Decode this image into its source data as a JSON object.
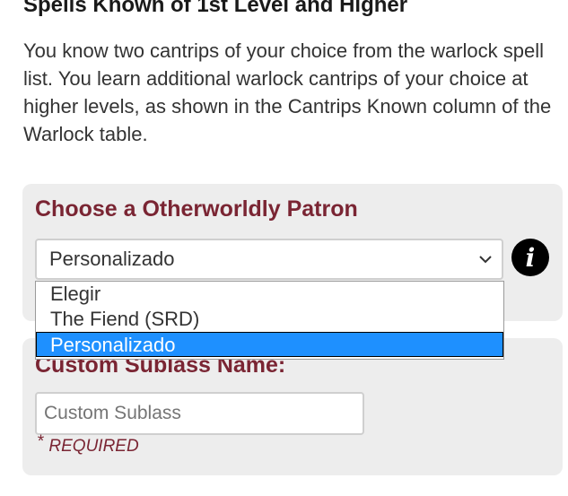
{
  "section": {
    "heading": "Spells Known of 1st Level and Higher",
    "paragraph": "You know two cantrips of your choice from the warlock spell list. You learn additional warlock cantrips of your choice at higher levels, as shown in the Cantrips Known column of the Warlock table."
  },
  "patron": {
    "title": "Choose a Otherworldly Patron",
    "selected_value": "Personalizado",
    "options": [
      {
        "label": "Elegir"
      },
      {
        "label": "The Fiend (SRD)"
      },
      {
        "label": "Personalizado"
      }
    ],
    "highlighted_option_index": 2
  },
  "custom_subclass": {
    "title": "Custom Sublass Name:",
    "placeholder": "Custom Sublass",
    "required_star": "*",
    "required_label": "REQUIRED"
  },
  "colors": {
    "accent": "#7a2533",
    "highlight": "#1e90ff",
    "card_background": "#ededed"
  },
  "icons": {
    "info": "info-icon",
    "dropdown": "chevron-down-icon"
  }
}
